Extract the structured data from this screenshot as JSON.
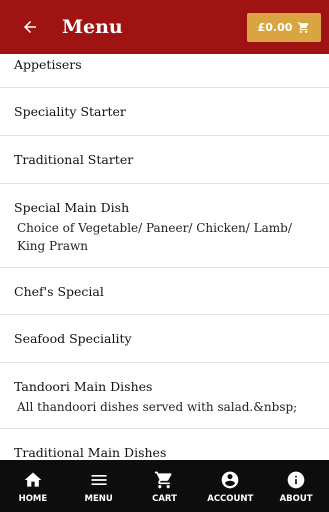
{
  "header": {
    "title": "Menu",
    "cart_total": "£0.00",
    "background_color": "#a01313",
    "cart_color": "#d9a441",
    "back_icon": "arrow-left-icon",
    "cart_icon": "shopping-cart-icon"
  },
  "menu": {
    "items": [
      {
        "title": "Appetisers",
        "description": ""
      },
      {
        "title": "Speciality Starter",
        "description": ""
      },
      {
        "title": "Traditional Starter",
        "description": ""
      },
      {
        "title": "Special Main Dish",
        "description": "Choice of Vegetable/ Paneer/ Chicken/ Lamb/ King Prawn"
      },
      {
        "title": "Chef's Special",
        "description": ""
      },
      {
        "title": "Seafood Speciality",
        "description": ""
      },
      {
        "title": "Tandoori Main Dishes",
        "description": "All thandoori dishes served with salad.&nbsp;"
      },
      {
        "title": "Traditional Main Dishes",
        "description": ""
      }
    ]
  },
  "bottom_nav": {
    "background_color": "#0d0d0d",
    "items": [
      {
        "label": "HOME",
        "icon": "home-icon"
      },
      {
        "label": "MENU",
        "icon": "hamburger-menu-icon"
      },
      {
        "label": "CART",
        "icon": "shopping-cart-icon"
      },
      {
        "label": "ACCOUNT",
        "icon": "account-circle-icon"
      },
      {
        "label": "ABOUT",
        "icon": "info-icon"
      }
    ]
  }
}
